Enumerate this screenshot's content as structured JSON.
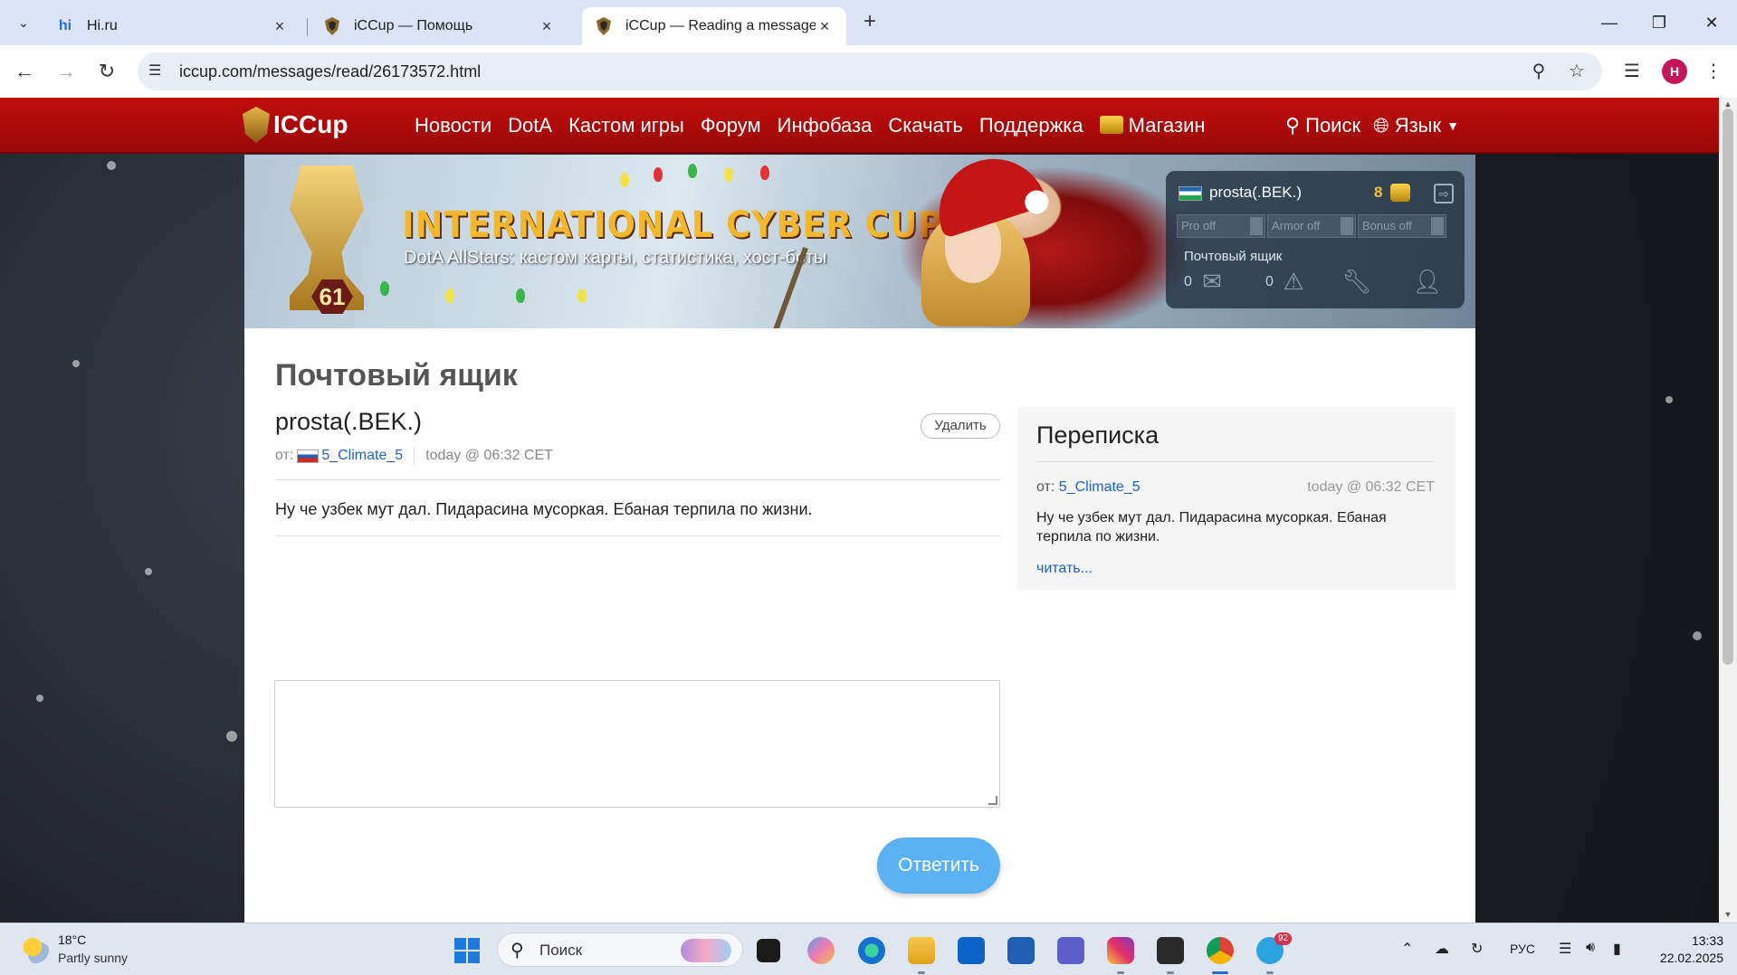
{
  "browser": {
    "tabs": [
      {
        "title": "Hi.ru",
        "favicon": "hi-ru-logo",
        "active": false
      },
      {
        "title": "iCCup — Помощь",
        "favicon": "iccup-shield",
        "active": false
      },
      {
        "title": "iCCup — Reading a message fro",
        "favicon": "iccup-shield",
        "active": true
      }
    ],
    "url": "iccup.com/messages/read/26173572.html",
    "profile_initial": "H"
  },
  "site": {
    "logo": "ICCup",
    "nav": [
      "Новости",
      "DotA",
      "Кастом игры",
      "Форум",
      "Инфобаза",
      "Скачать",
      "Поддержка",
      "Магазин"
    ],
    "search_label": "Поиск",
    "language_label": "Язык",
    "banner_title": "INTERNATIONAL CYBER CUP",
    "banner_subtitle": "DotA AllStars: кастом карты, статистика, хост-боты",
    "level": "61"
  },
  "user_panel": {
    "username": "prosta(.BEK.)",
    "coins": "8",
    "stats": [
      "Pro off",
      "Armor off",
      "Bonus off"
    ],
    "mailbox_label": "Почтовый ящик",
    "mail_count": "0",
    "warnings_count": "0"
  },
  "mailbox": {
    "page_title": "Почтовый ящик",
    "subject": "prosta(.BEK.)",
    "delete_label": "Удалить",
    "from_label": "от:",
    "sender": "5_Climate_5",
    "time": "today @ 06:32 CET",
    "body": "Ну че узбек мут дал. Пидарасина мусоркая. Ебаная терпила по жизни.",
    "reply_label": "Ответить"
  },
  "correspondence": {
    "title": "Переписка",
    "from_label": "от:",
    "sender": "5_Climate_5",
    "time": "today @ 06:32 CET",
    "text": "Ну че узбек мут дал. Пидарасина мусоркая. Ебаная терпила по жизни.",
    "read_more": "читать..."
  },
  "taskbar": {
    "temperature": "18°C",
    "weather": "Partly sunny",
    "search_placeholder": "Поиск",
    "language": "РУС",
    "time": "13:33",
    "date": "22.02.2025",
    "telegram_badge": "92"
  }
}
